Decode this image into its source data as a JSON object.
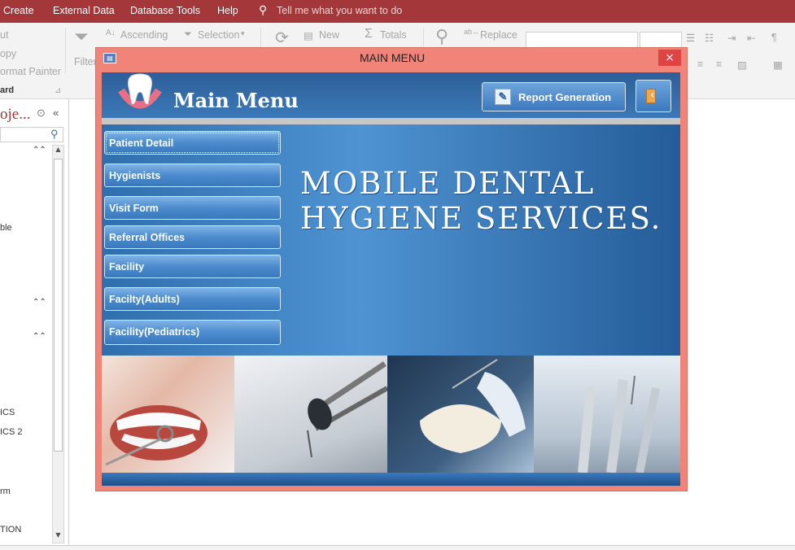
{
  "menubar": {
    "items": [
      "Create",
      "External Data",
      "Database Tools",
      "Help"
    ],
    "tell_me": "Tell me what you want to do"
  },
  "ribbon": {
    "cut": "ut",
    "copy": "opy",
    "format_painter": "ormat Painter",
    "clipboard_group": "ard",
    "filter": "Filter",
    "ascending": "Ascending",
    "selection": "Selection",
    "new": "New",
    "totals": "Totals",
    "replace": "Replace"
  },
  "nav": {
    "title": "oje...",
    "items": [
      "ble",
      "ICS",
      "ICS 2",
      "rm",
      "TION"
    ]
  },
  "dialog": {
    "window_title": "MAIN MENU",
    "close_glyph": "×",
    "heading": "Main Menu",
    "report_button": "Report Generation",
    "banner_line1": "MOBILE DENTAL",
    "banner_line2": "HYGIENE SERVICES.",
    "menu_buttons": [
      "Patient Detail",
      "Hygienists",
      "Visit Form",
      "Referral Offices",
      "Facility",
      "Facilty(Adults)",
      "Facility(Pediatrics)"
    ]
  },
  "colors": {
    "access_red": "#a4373a",
    "dialog_frame": "#f08478",
    "form_blue": "#2f6fae"
  }
}
